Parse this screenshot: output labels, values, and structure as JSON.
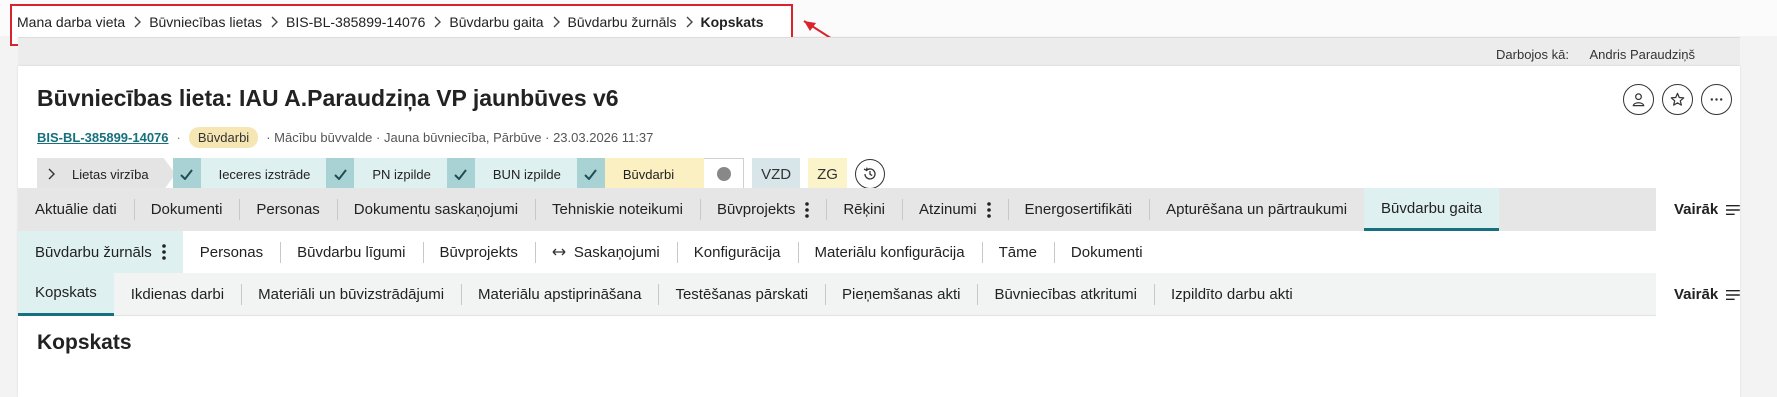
{
  "breadcrumb": {
    "items": [
      "Mana darba vieta",
      "Būvniecības lietas",
      "BIS-BL-385899-14076",
      "Būvdarbu gaita",
      "Būvdarbu žurnāls",
      "Kopskats"
    ]
  },
  "user_bar": {
    "label": "Darbojos kā:",
    "name": "Andris Paraudziņš"
  },
  "header": {
    "title": "Būvniecības lieta: IAU A.Paraudziņa VP jaunbūves v6",
    "case_number": "BIS-BL-385899-14076",
    "badge": "Būvdarbi",
    "meta_text": "· Mācību būvvalde · Jauna būvniecība, Pārbūve · 23.03.2026 11:37",
    "actions": [
      "user-icon",
      "star-icon",
      "more-horizontal-icon"
    ]
  },
  "workflow": {
    "start_label": "Lietas virzība",
    "steps": [
      {
        "label": "Ieceres izstrāde",
        "done": true
      },
      {
        "label": "PN izpilde",
        "done": true
      },
      {
        "label": "BUN izpilde",
        "done": true
      },
      {
        "label": "Būvdarbi",
        "done": true,
        "active": true
      }
    ],
    "tags": [
      "VZD",
      "ZG"
    ]
  },
  "tabs_primary": {
    "items": [
      "Aktuālie dati",
      "Dokumenti",
      "Personas",
      "Dokumentu saskaņojumi",
      "Tehniskie noteikumi",
      "Būvprojekts",
      "Rēķini",
      "Atzinumi",
      "Energosertifikāti",
      "Apturēšana un pārtraukumi",
      "Būvdarbu gaita"
    ],
    "active": "Būvdarbu gaita",
    "more": "Vairāk"
  },
  "tabs_secondary": {
    "items": [
      "Būvdarbu žurnāls",
      "Personas",
      "Būvdarbu līgumi",
      "Būvprojekts",
      "Saskaņojumi",
      "Konfigurācija",
      "Materiālu konfigurācija",
      "Tāme",
      "Dokumenti"
    ],
    "active": "Būvdarbu žurnāls"
  },
  "tabs_tertiary": {
    "items": [
      "Kopskats",
      "Ikdienas darbi",
      "Materiāli un būvizstrādājumi",
      "Materiālu apstiprināšana",
      "Testēšanas pārskati",
      "Pieņemšanas akti",
      "Būvniecības atkritumi",
      "Izpildīto darbu akti"
    ],
    "active": "Kopskats",
    "more": "Vairāk"
  },
  "section": {
    "title": "Kopskats"
  },
  "colors": {
    "accent": "#16707e",
    "highlight_frame": "#d9232d",
    "active_tab_bg": "#dff0f0"
  }
}
